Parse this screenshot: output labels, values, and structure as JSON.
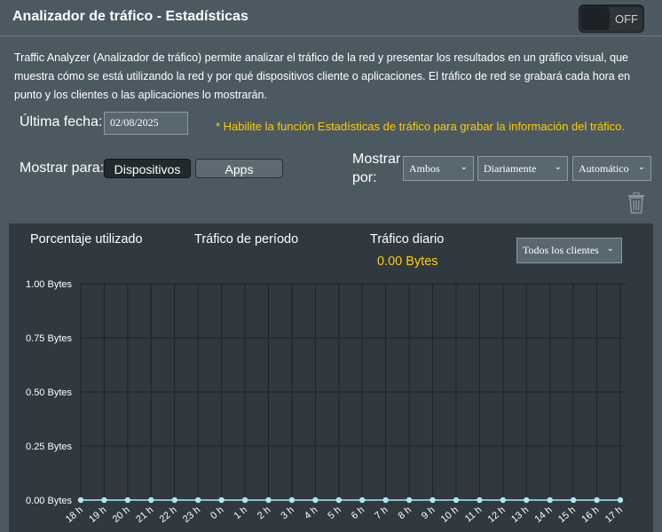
{
  "header": {
    "title": "Analizador de tráfico - Estadísticas",
    "toggle_label": "OFF"
  },
  "description": "Traffic Analyzer (Analizador de tráfico) permite analizar el tráfico de la red y presentar los resultados en un gráfico visual, que muestra cómo se está utilizando la red y por qué dispositivos cliente o aplicaciones. El tráfico de red se grabará cada hora en punto y los clientes o las aplicaciones lo mostrarán.",
  "last_date": {
    "label": "Última fecha:",
    "value": "02/08/2025"
  },
  "hint": "* Habilite la función Estadísticas de tráfico para grabar la información del tráfico.",
  "show_for": {
    "label": "Mostrar para:",
    "options": [
      "Dispositivos",
      "Apps"
    ],
    "selected": "Dispositivos"
  },
  "show_by": {
    "label_line1": "Mostrar",
    "label_line2": "por:",
    "direction": "Ambos",
    "period": "Diariamente",
    "unit": "Automático"
  },
  "panel": {
    "tab_usage": "Porcentaje utilizado",
    "tab_period": "Tráfico de período",
    "tab_daily": "Tráfico diario",
    "daily_value": "0.00 Bytes",
    "clients_select": "Todos los clientes"
  },
  "chart_data": {
    "type": "line",
    "categories": [
      "18 h",
      "19 h",
      "20 h",
      "21 h",
      "22 h",
      "23 h",
      "0 h",
      "1 h",
      "2 h",
      "3 h",
      "4 h",
      "5 h",
      "6 h",
      "7 h",
      "8 h",
      "9 h",
      "10 h",
      "11 h",
      "12 h",
      "13 h",
      "14 h",
      "15 h",
      "16 h",
      "17 h"
    ],
    "values": [
      0,
      0,
      0,
      0,
      0,
      0,
      0,
      0,
      0,
      0,
      0,
      0,
      0,
      0,
      0,
      0,
      0,
      0,
      0,
      0,
      0,
      0,
      0,
      0
    ],
    "y_ticks": [
      "0.00 Bytes",
      "0.25 Bytes",
      "0.50 Bytes",
      "0.75 Bytes",
      "1.00 Bytes"
    ],
    "ylim": [
      0,
      1
    ],
    "grid": true,
    "line_color": "#aee6ff"
  }
}
